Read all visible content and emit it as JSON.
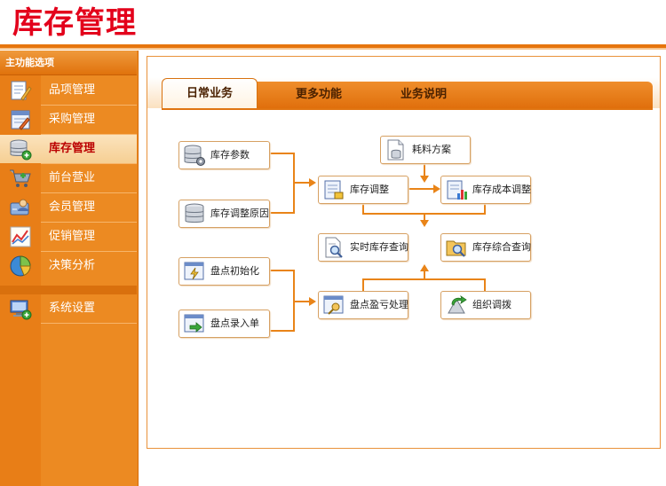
{
  "page_title": "库存管理",
  "sidebar": {
    "header": "主功能选项",
    "items": [
      {
        "label": "品项管理",
        "icon": "document-pencil-icon"
      },
      {
        "label": "采购管理",
        "icon": "edit-form-icon"
      },
      {
        "label": "库存管理",
        "icon": "database-add-icon",
        "active": true
      },
      {
        "label": "前台营业",
        "icon": "shopping-cart-icon"
      },
      {
        "label": "会员管理",
        "icon": "member-card-icon"
      },
      {
        "label": "促销管理",
        "icon": "trend-chart-icon"
      },
      {
        "label": "决策分析",
        "icon": "pie-chart-icon"
      },
      {
        "label": "系统设置",
        "icon": "computer-settings-icon"
      }
    ]
  },
  "tabs": [
    {
      "label": "日常业务",
      "active": true
    },
    {
      "label": "更多功能"
    },
    {
      "label": "业务说明"
    }
  ],
  "flow": {
    "stock_params": "库存参数",
    "stock_adjust_reason": "库存调整原因",
    "material_plan": "耗料方案",
    "stock_adjust": "库存调整",
    "stock_cost_adjust": "库存成本调整",
    "realtime_stock_query": "实时库存查询",
    "stock_summary_query": "库存综合查询",
    "inventory_init": "盘点初始化",
    "inventory_entry": "盘点录入单",
    "inventory_profit_loss": "盘点盈亏处理",
    "stock_transfer": "组织调拨"
  },
  "colors": {
    "title_red": "#e3001b",
    "accent_orange": "#e6750d",
    "sidebar_bg": "#ec8a22"
  }
}
